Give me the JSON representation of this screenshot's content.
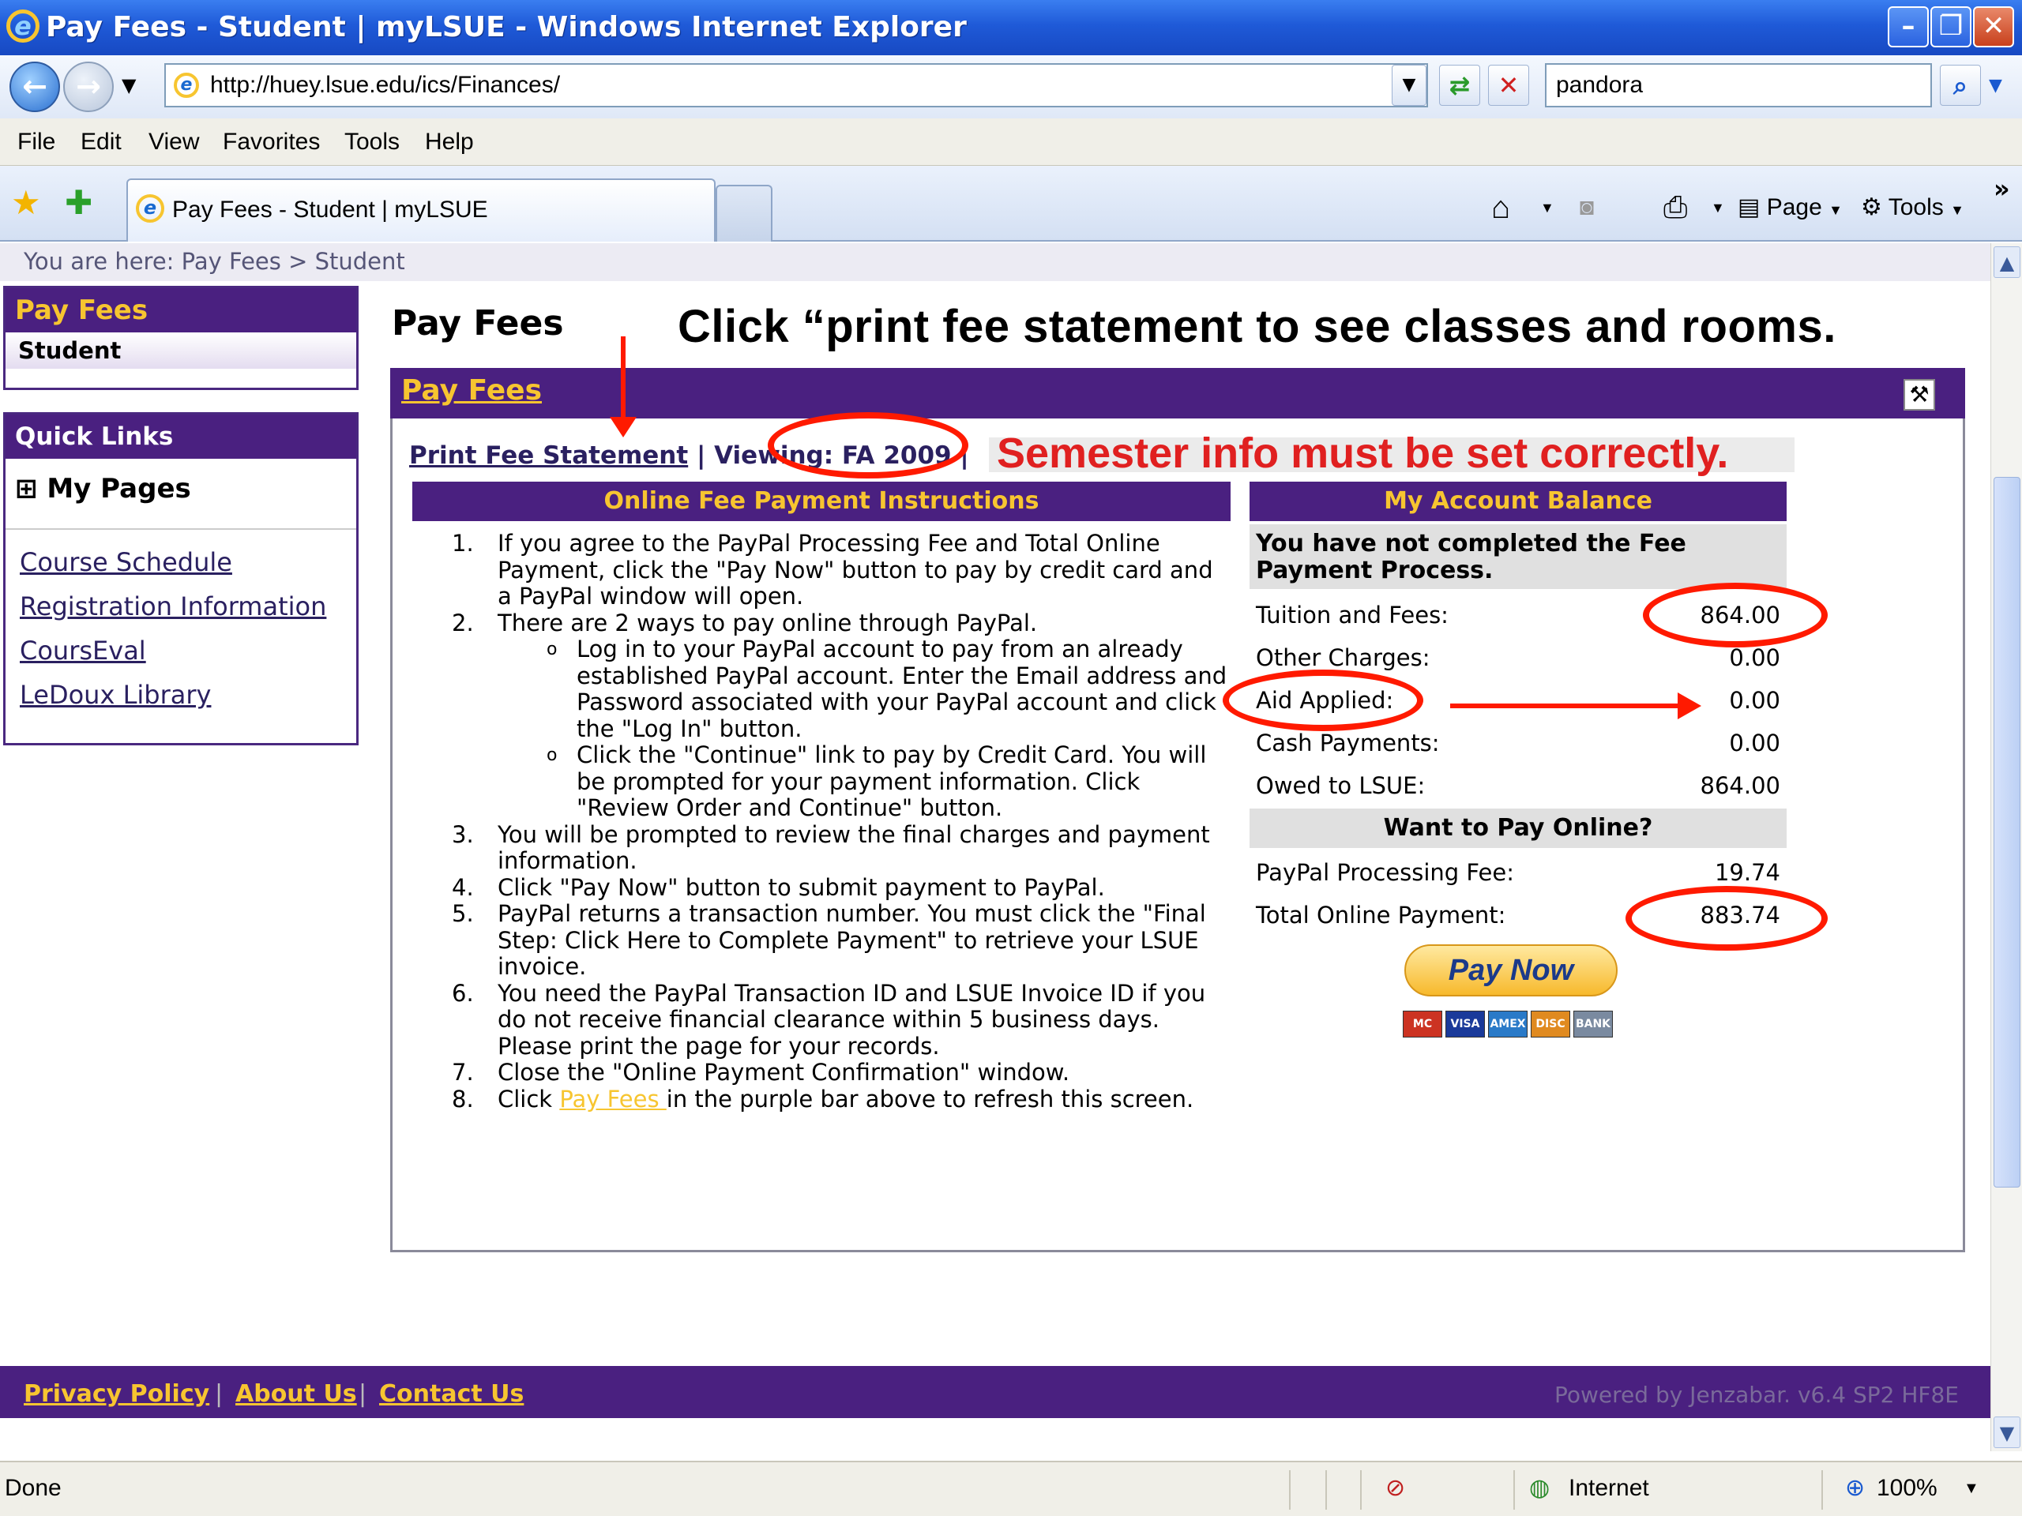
{
  "window": {
    "title": "Pay Fees - Student | myLSUE - Windows Internet Explorer",
    "minimize": "–",
    "maximize": "❐",
    "close": "✕"
  },
  "nav": {
    "back": "←",
    "forward": "→",
    "address": "http://huey.lsue.edu/ics/Finances/",
    "refresh": "⇄",
    "stop": "✕",
    "search_value": "pandora",
    "search_btn": "⌕"
  },
  "menu": [
    "File",
    "Edit",
    "View",
    "Favorites",
    "Tools",
    "Help"
  ],
  "tab": {
    "title": "Pay Fees - Student | myLSUE"
  },
  "toolbar": {
    "page": "Page",
    "tools": "Tools",
    "more": "»"
  },
  "breadcrumb": "You are here:  Pay Fees > Student",
  "sidebar": {
    "pay_fees_header": "Pay Fees",
    "student_item": "Student",
    "quick_links_header": "Quick Links",
    "my_pages": "My Pages",
    "expand": "⊞",
    "links": [
      "Course Schedule",
      "Registration Information",
      "CoursEval",
      "LeDoux Library"
    ]
  },
  "main": {
    "page_title": "Pay Fees",
    "instruction_overlay": "Click “print fee statement to see classes and rooms.",
    "portlet_title": "Pay Fees",
    "print_link": "Print Fee Statement",
    "viewing": " | Viewing: FA 2009 |",
    "semester_note": "Semester info must be set correctly.",
    "instructions_header": "Online Fee Payment Instructions",
    "steps": [
      {
        "n": "1.",
        "text": "If you agree to the PayPal Processing Fee and Total Online Payment, click the \"Pay Now\" button to pay by credit card and a PayPal window will open."
      },
      {
        "n": "2.",
        "text": "There are 2 ways to pay online through PayPal."
      },
      {
        "n": "3.",
        "text": "You will be prompted to review the final charges and payment information."
      },
      {
        "n": "4.",
        "text": "Click \"Pay Now\" button to submit payment to PayPal."
      },
      {
        "n": "5.",
        "text": "PayPal returns a transaction number. You must click the \"Final Step: Click Here to Complete Payment\" to retrieve your LSUE invoice."
      },
      {
        "n": "6.",
        "text": "You need the PayPal Transaction ID and LSUE Invoice ID if you do not receive financial clearance within 5 business days. Please print the page for your records."
      },
      {
        "n": "7.",
        "text": "Close the \"Online Payment Confirmation\" window."
      },
      {
        "n": "8.",
        "pre": "Click ",
        "link": "Pay Fees ",
        "post": "in the purple bar above to refresh this screen."
      }
    ],
    "substeps": [
      "Log in to your PayPal account to pay from an already established PayPal account. Enter the Email address and Password associated with your PayPal account and click the \"Log In\" button.",
      "Click the \"Continue\" link to pay by Credit Card. You will be prompted for your payment information. Click \"Review Order and Continue\" button."
    ],
    "bullet": "o"
  },
  "balance": {
    "header": "My Account Balance",
    "notice": "You have not completed the Fee Payment Process.",
    "rows": [
      {
        "label": "Tuition and Fees:",
        "value": "864.00"
      },
      {
        "label": "Other Charges:",
        "value": "0.00"
      },
      {
        "label": "Aid Applied:",
        "value": "0.00"
      },
      {
        "label": "Cash Payments:",
        "value": "0.00"
      },
      {
        "label": "Owed to LSUE:",
        "value": "864.00"
      }
    ],
    "pay_online_header": "Want to Pay Online?",
    "paypal_fee_label": "PayPal Processing Fee:",
    "paypal_fee": "19.74",
    "total_label": "Total Online Payment:",
    "total": "883.74",
    "pay_now": "Pay Now",
    "cards": [
      "MC",
      "VISA",
      "AMEX",
      "DISC",
      "BANK"
    ]
  },
  "footer": {
    "links": [
      "Privacy Policy",
      "About Us",
      "Contact Us"
    ],
    "sep": "|",
    "powered": "Powered by Jenzabar. v6.4 SP2 HF8E"
  },
  "status": {
    "left": "Done",
    "zone": "Internet",
    "zoom": "100%"
  },
  "colors": {
    "purple": "#4a2080",
    "gold": "#f7c530",
    "annotation_red": "#ff1a00"
  },
  "icons": [
    "ie-logo-icon",
    "back-arrow-icon",
    "forward-arrow-icon",
    "favorites-star-icon",
    "add-favorites-icon",
    "home-icon",
    "rss-icon",
    "print-icon",
    "page-icon",
    "tools-gear-icon",
    "edit-icon",
    "globe-icon",
    "zoom-icon"
  ]
}
